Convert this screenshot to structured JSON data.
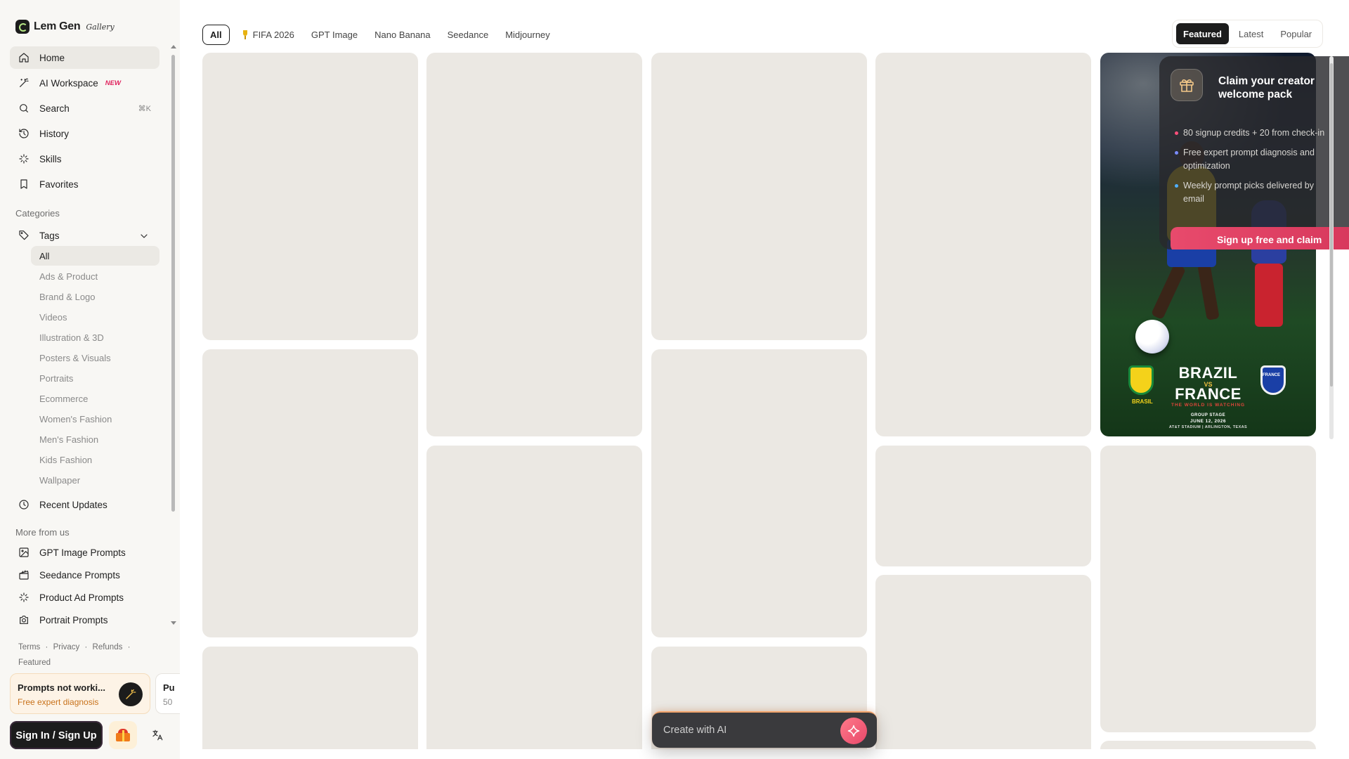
{
  "brand": {
    "name": "Lem Gen",
    "sub": "Gallery"
  },
  "nav": {
    "items": [
      {
        "label": "Home",
        "icon": "home-icon"
      },
      {
        "label": "AI Workspace",
        "icon": "wand-icon",
        "badge": "NEW"
      },
      {
        "label": "Search",
        "icon": "search-icon",
        "shortcut": "⌘K"
      },
      {
        "label": "History",
        "icon": "history-icon"
      },
      {
        "label": "Skills",
        "icon": "sparkles-icon"
      },
      {
        "label": "Favorites",
        "icon": "bookmark-icon"
      }
    ]
  },
  "categories": {
    "heading": "Categories",
    "tags_label": "Tags",
    "tags": [
      "All",
      "Ads & Product",
      "Brand & Logo",
      "Videos",
      "Illustration & 3D",
      "Posters & Visuals",
      "Portraits",
      "Ecommerce",
      "Women's Fashion",
      "Men's Fashion",
      "Kids Fashion",
      "Wallpaper"
    ],
    "recent_label": "Recent Updates"
  },
  "more": {
    "heading": "More from us",
    "items": [
      "GPT Image Prompts",
      "Seedance Prompts",
      "Product Ad Prompts",
      "Portrait Prompts"
    ]
  },
  "footer": {
    "terms": "Terms",
    "privacy": "Privacy",
    "refunds": "Refunds",
    "featured": "Featured",
    "sep": "·"
  },
  "promo": {
    "title": "Prompts not worki...",
    "subtitle": "Free expert diagnosis",
    "peek_title": "Pu",
    "peek_sub": "50"
  },
  "auth": {
    "signin": "Sign In / Sign Up"
  },
  "filters": [
    "All",
    "FIFA 2026",
    "GPT Image",
    "Nano Banana",
    "Seedance",
    "Midjourney"
  ],
  "sort": [
    "Featured",
    "Latest",
    "Popular"
  ],
  "feature": {
    "team1": "BRAZIL",
    "vs": "VS",
    "team2": "FRANCE",
    "tagline": "THE WORLD IS WATCHING",
    "stage": "GROUP STAGE",
    "date": "JUNE 12, 2026",
    "venue": "AT&T STADIUM | ARLINGTON, TEXAS",
    "crest1": "BRASIL",
    "crest2": "FRANCE"
  },
  "pack": {
    "title": "Claim your creator welcome pack",
    "items": [
      "80 signup credits + 20 from check-in",
      "Free expert prompt diagnosis and optimization",
      "Weekly prompt picks delivered by email"
    ],
    "cta": "Sign up free and claim"
  },
  "create": {
    "placeholder": "Create with AI"
  },
  "colors": {
    "accent": "#e84a6c",
    "placeholder_card": "#ebe8e3",
    "dark": "#1c1c1c"
  }
}
